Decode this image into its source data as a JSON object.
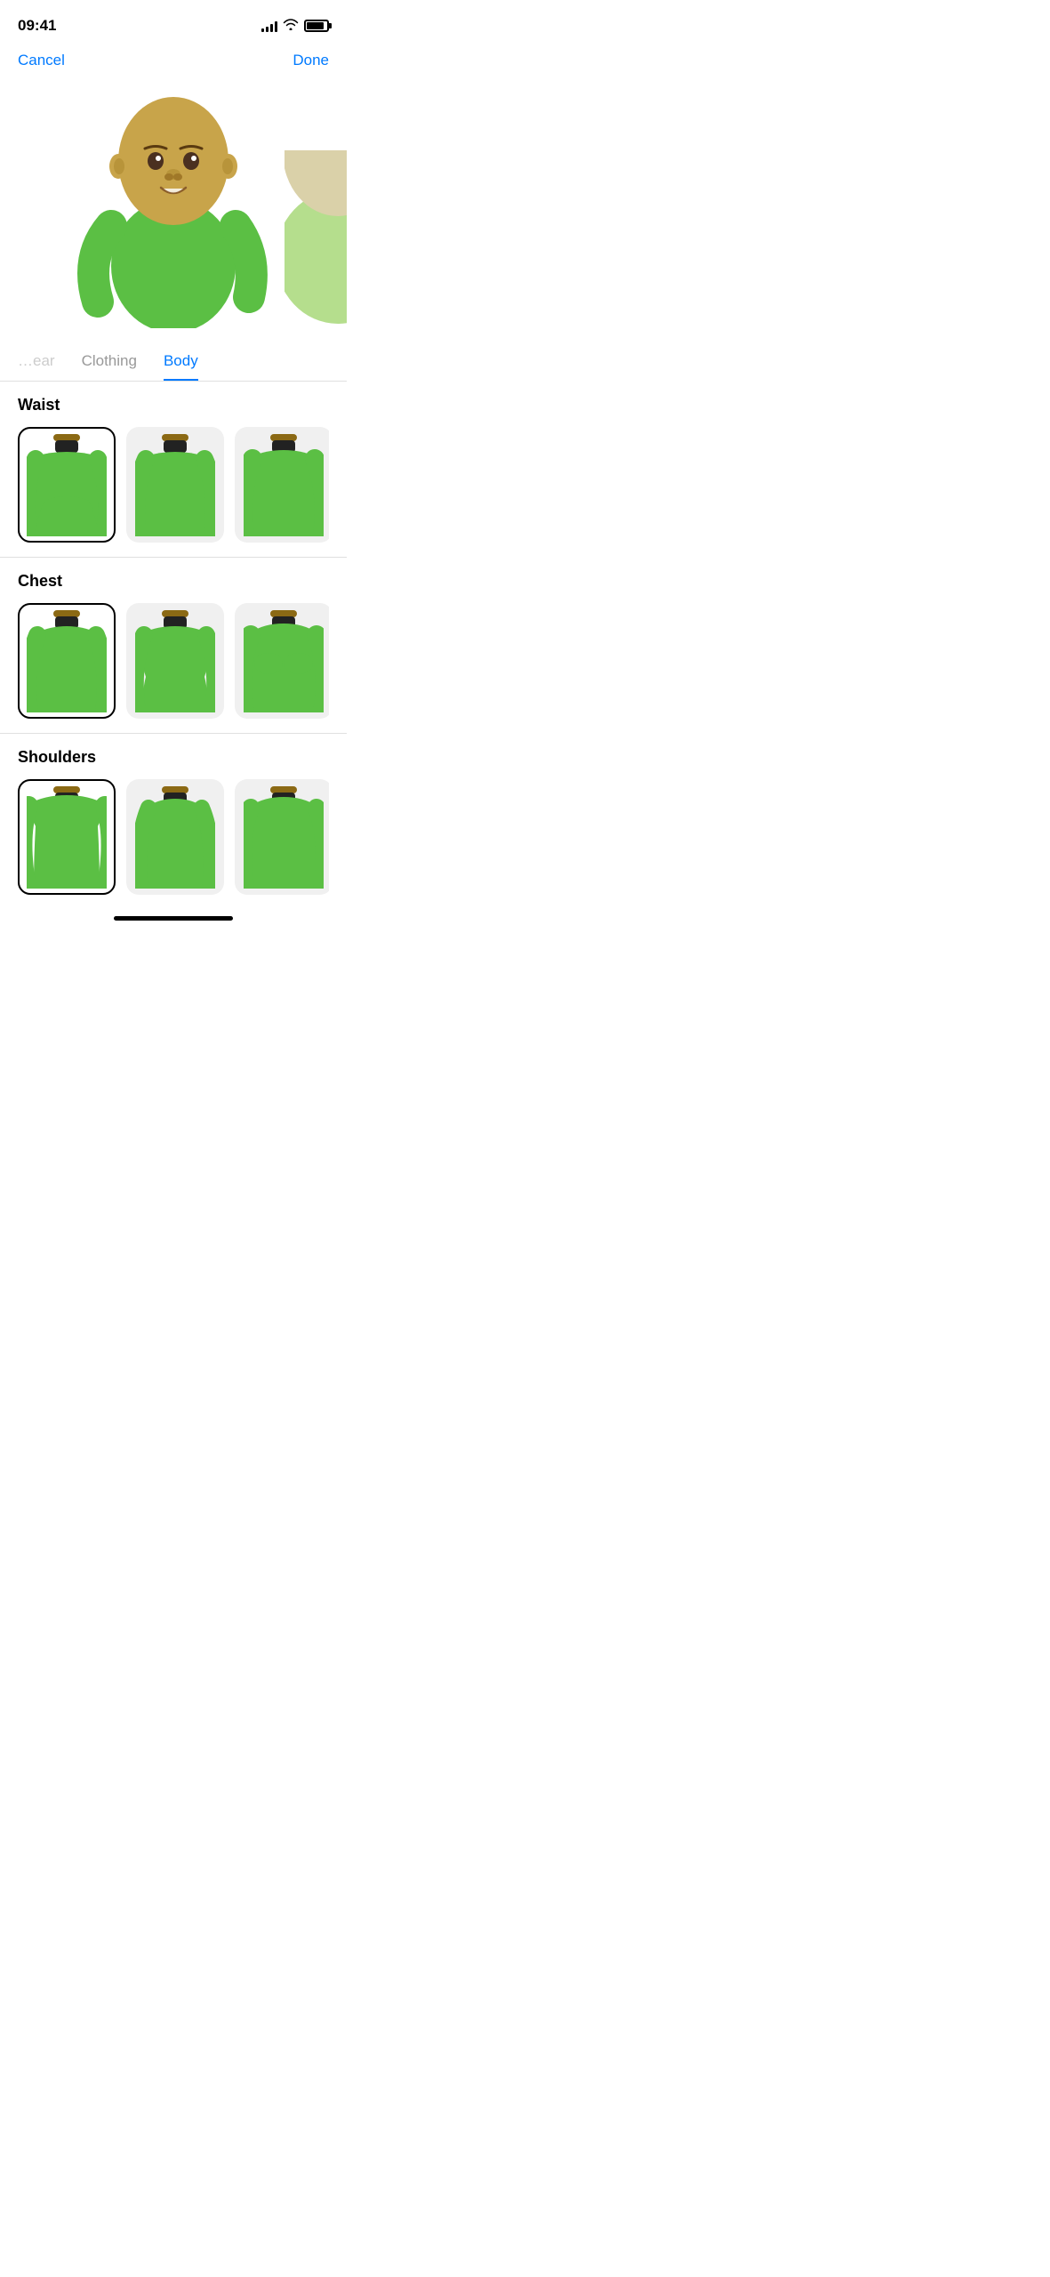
{
  "statusBar": {
    "time": "09:41",
    "signalBars": [
      4,
      6,
      8,
      10,
      12
    ],
    "batteryLevel": 85
  },
  "nav": {
    "cancelLabel": "Cancel",
    "doneLabel": "Done"
  },
  "tabs": [
    {
      "id": "headwear",
      "label": "…ear",
      "active": false,
      "partial": true
    },
    {
      "id": "clothing",
      "label": "Clothing",
      "active": false
    },
    {
      "id": "body",
      "label": "Body",
      "active": true
    }
  ],
  "sections": [
    {
      "id": "waist",
      "title": "Waist",
      "options": [
        {
          "id": "waist-1",
          "selected": true
        },
        {
          "id": "waist-2",
          "selected": false
        },
        {
          "id": "waist-3",
          "selected": false
        }
      ]
    },
    {
      "id": "chest",
      "title": "Chest",
      "options": [
        {
          "id": "chest-1",
          "selected": true
        },
        {
          "id": "chest-2",
          "selected": false
        },
        {
          "id": "chest-3",
          "selected": false
        }
      ]
    },
    {
      "id": "shoulders",
      "title": "Shoulders",
      "options": [
        {
          "id": "shoulders-1",
          "selected": true
        },
        {
          "id": "shoulders-2",
          "selected": false
        },
        {
          "id": "shoulders-3",
          "selected": false
        }
      ]
    }
  ],
  "colors": {
    "accent": "#007AFF",
    "bodyGreen": "#4CAF50",
    "bodyGreenLight": "#81C784",
    "bodyGreenDark": "#388E3C",
    "skinTone": "#C8A44A",
    "neckDark": "#222",
    "collar": "#8B6914"
  }
}
